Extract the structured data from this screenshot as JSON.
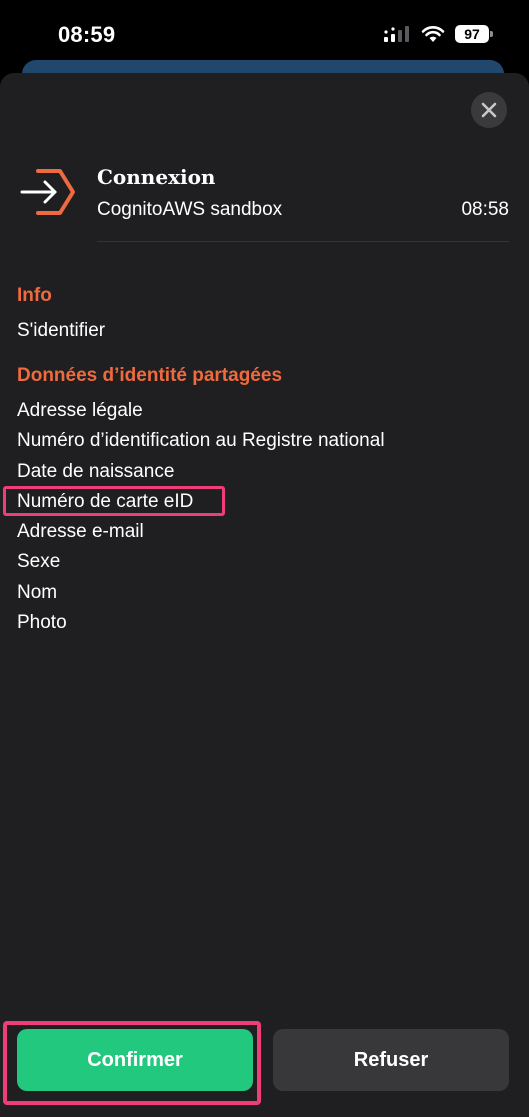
{
  "status_bar": {
    "time": "08:59",
    "battery_level": "97",
    "icons": [
      "cellular-signal-icon",
      "wifi-icon",
      "battery-icon"
    ]
  },
  "sheet": {
    "close_icon": "close-icon",
    "login_icon": "login-arrow-hexagon-icon",
    "title": "Connexion",
    "subtitle": "CognitoAWS sandbox",
    "time": "08:58"
  },
  "info": {
    "heading": "Info",
    "text": "S'identifier"
  },
  "shared": {
    "heading": "Données d’identité partagées",
    "items": [
      "Adresse légale",
      "Numéro d’identification au Registre national",
      "Date de naissance",
      "Numéro de carte eID",
      "Adresse e-mail",
      "Sexe",
      "Nom",
      "Photo"
    ]
  },
  "actions": {
    "confirm_label": "Confirmer",
    "refuse_label": "Refuser"
  },
  "colors": {
    "accent_orange": "#ef6a3e",
    "confirm_green": "#22c87e",
    "highlight_pink": "#ef3d78",
    "sheet_background": "#1f1f21"
  }
}
